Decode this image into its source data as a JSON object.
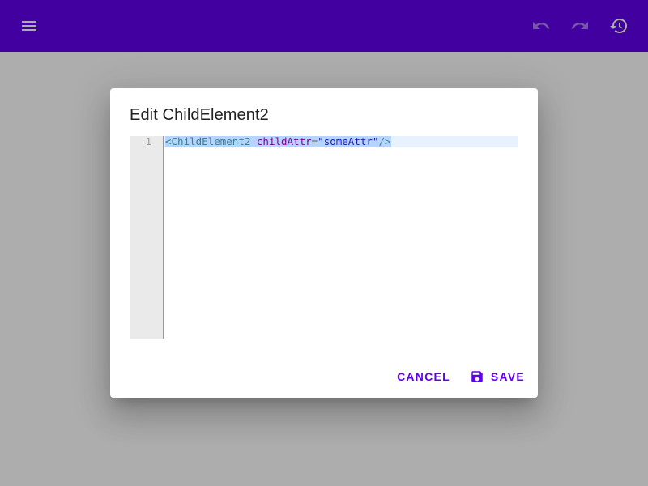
{
  "appbar": {
    "background": "#6200ee",
    "icons": {
      "menu": "menu-icon",
      "undo": "undo-icon",
      "redo": "redo-icon",
      "history": "history-icon"
    },
    "undo_enabled": false,
    "redo_enabled": false,
    "history_enabled": true
  },
  "dialog": {
    "title": "Edit ChildElement2",
    "editor": {
      "line_numbers": [
        "1"
      ],
      "tokens": {
        "open": "<",
        "tag": "ChildElement2",
        "attr_name": "childAttr",
        "equals": "=",
        "attr_value": "\"someAttr\"",
        "close": "/>"
      }
    },
    "actions": {
      "cancel_label": "Cancel",
      "save_label": "Save",
      "save_icon": "save-icon"
    }
  },
  "colors": {
    "accent": "#6200ee",
    "scrim": "rgba(0,0,0,0.32)",
    "selection": "#b5d5ff",
    "active_line": "#e8f2ff"
  }
}
